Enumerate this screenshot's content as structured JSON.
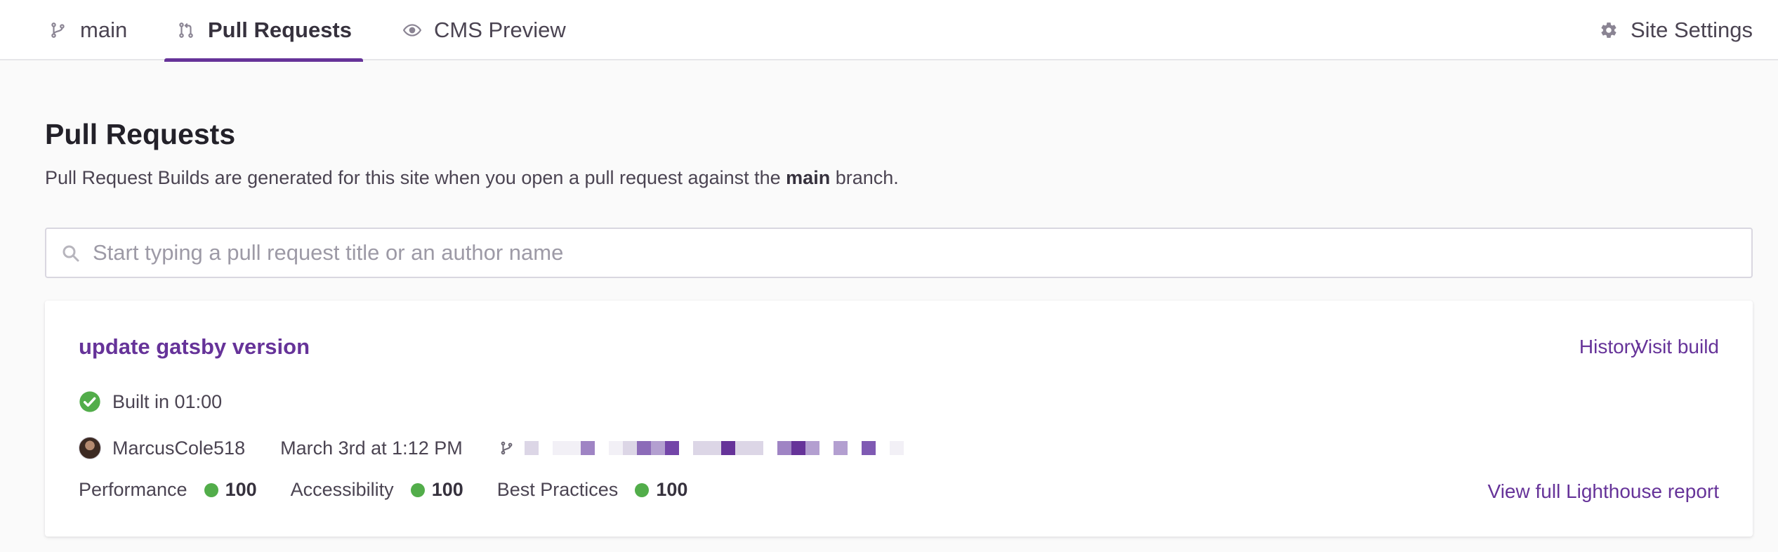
{
  "nav": {
    "tabs": [
      {
        "label": "main",
        "icon": "branch-icon"
      },
      {
        "label": "Pull Requests",
        "icon": "pull-request-icon",
        "active": true
      },
      {
        "label": "CMS Preview",
        "icon": "eye-icon"
      }
    ],
    "settings_label": "Site Settings",
    "settings_icon": "gear-icon"
  },
  "page": {
    "title": "Pull Requests",
    "description_prefix": "Pull Request Builds are generated for this site when you open a pull request against the ",
    "description_branch": "main",
    "description_suffix": " branch."
  },
  "search": {
    "placeholder": "Start typing a pull request title or an author name",
    "value": ""
  },
  "pull_request": {
    "title": "update gatsby version",
    "history_label": "History",
    "visit_label": "Visit build",
    "status": "Built in 01:00",
    "author": "MarcusCole518",
    "date": "March 3rd at 1:12 PM",
    "commit_pixels": [
      "#dcd6e6",
      "#ffffff",
      "#f2f0f6",
      "#f2f0f6",
      "#9f84c4",
      "#ffffff",
      "#f2f0f6",
      "#dcd6e6",
      "#8c6bb8",
      "#b39fd0",
      "#7345a8",
      "#ffffff",
      "#dcd6e6",
      "#dcd6e6",
      "#663399",
      "#dcd6e6",
      "#dcd6e6",
      "#ffffff",
      "#9f84c4",
      "#663399",
      "#b39fd0",
      "#ffffff",
      "#b39fd0",
      "#ffffff",
      "#7f5ab3",
      "#ffffff",
      "#f2f0f6"
    ],
    "scores": [
      {
        "label": "Performance",
        "value": "100"
      },
      {
        "label": "Accessibility",
        "value": "100"
      },
      {
        "label": "Best Practices",
        "value": "100"
      }
    ],
    "lighthouse_label": "View full Lighthouse report"
  },
  "colors": {
    "accent": "#663399",
    "success": "#52ad4a"
  }
}
